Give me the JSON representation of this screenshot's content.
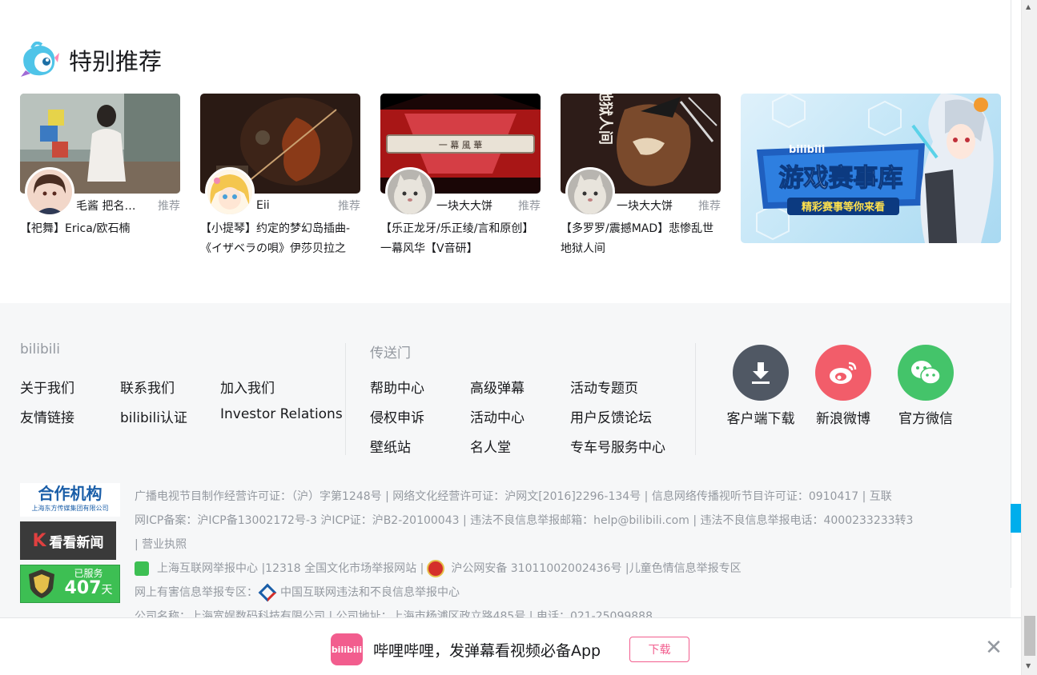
{
  "section": {
    "title": "特别推荐",
    "icon": "mascot-icon"
  },
  "cards": [
    {
      "uploader": "毛酱 把名…",
      "tag": "推荐",
      "title": "【祀舞】Erica/欧石楠"
    },
    {
      "uploader": "Eii",
      "tag": "推荐",
      "title": "【小提琴】约定的梦幻岛插曲-《イザベラの唄》伊莎贝拉之"
    },
    {
      "uploader": "一块大大饼",
      "tag": "推荐",
      "title": "【乐正龙牙/乐正绫/言和原创】一幕风华【V音研】"
    },
    {
      "uploader": "一块大大饼",
      "tag": "推荐",
      "title": "【多罗罗/震撼MAD】悲惨乱世 地狱人间"
    }
  ],
  "banner": {
    "brand": "bilibili",
    "headline": "游戏赛事库",
    "sub": "精彩赛事等你来看"
  },
  "thumb_text": {
    "card3_plate": "一 幕 風 華",
    "card4_calligraphy": "地狱人间"
  },
  "footer": {
    "col1": {
      "title": "bilibili",
      "links": [
        "关于我们",
        "联系我们",
        "加入我们",
        "友情链接",
        "bilibili认证",
        "Investor Relations"
      ]
    },
    "col2": {
      "title": "传送门",
      "links": [
        "帮助中心",
        "高级弹幕",
        "活动专题页",
        "侵权申诉",
        "活动中心",
        "用户反馈论坛",
        "壁纸站",
        "名人堂",
        "专车号服务中心"
      ]
    },
    "social": [
      {
        "label": "客户端下载",
        "icon": "download-icon",
        "color": "#505864"
      },
      {
        "label": "新浪微博",
        "icon": "weibo-icon",
        "color": "#f25d6a"
      },
      {
        "label": "官方微信",
        "icon": "wechat-icon",
        "color": "#44c46a"
      }
    ],
    "partners": {
      "coop_title": "合作机构",
      "coop_sub": "上海东方传媒集团有限公司",
      "kankan": "看看新闻",
      "served_label": "已服务",
      "served_days": "407",
      "served_unit": "天"
    },
    "license": {
      "line1": "广播电视节目制作经营许可证：（沪）字第1248号 | 网络文化经营许可证：沪网文[2016]2296-134号 | 信息网络传播视听节目许可证：0910417 | 互联",
      "line2": "网ICP备案：沪ICP备13002172号-3 沪ICP证：沪B2-20100043 | 违法不良信息举报邮箱：help@bilibili.com | 违法不良信息举报电话：4000233233转3",
      "line3": "| 营业执照",
      "line4a": "上海互联网举报中心 |12318 全国文化市场举报网站 |",
      "line4b": "沪公网安备 31011002002436号 |儿童色情信息举报专区",
      "line5a": "网上有害信息举报专区：",
      "line5b": "中国互联网违法和不良信息举报中心",
      "line6": "公司名称：上海宽娱数码科技有限公司 | 公司地址：上海市杨浦区政立路485号 | 电话：021-25099888"
    }
  },
  "download_bar": {
    "logo": "bilibili",
    "text": "哔哩哔哩，发弹幕看视频必备App",
    "button": "下载",
    "close": "✕"
  },
  "colors": {
    "brand_pink": "#f25d8e",
    "brand_blue": "#00aeec",
    "footer_bg": "#f6f7f8"
  }
}
